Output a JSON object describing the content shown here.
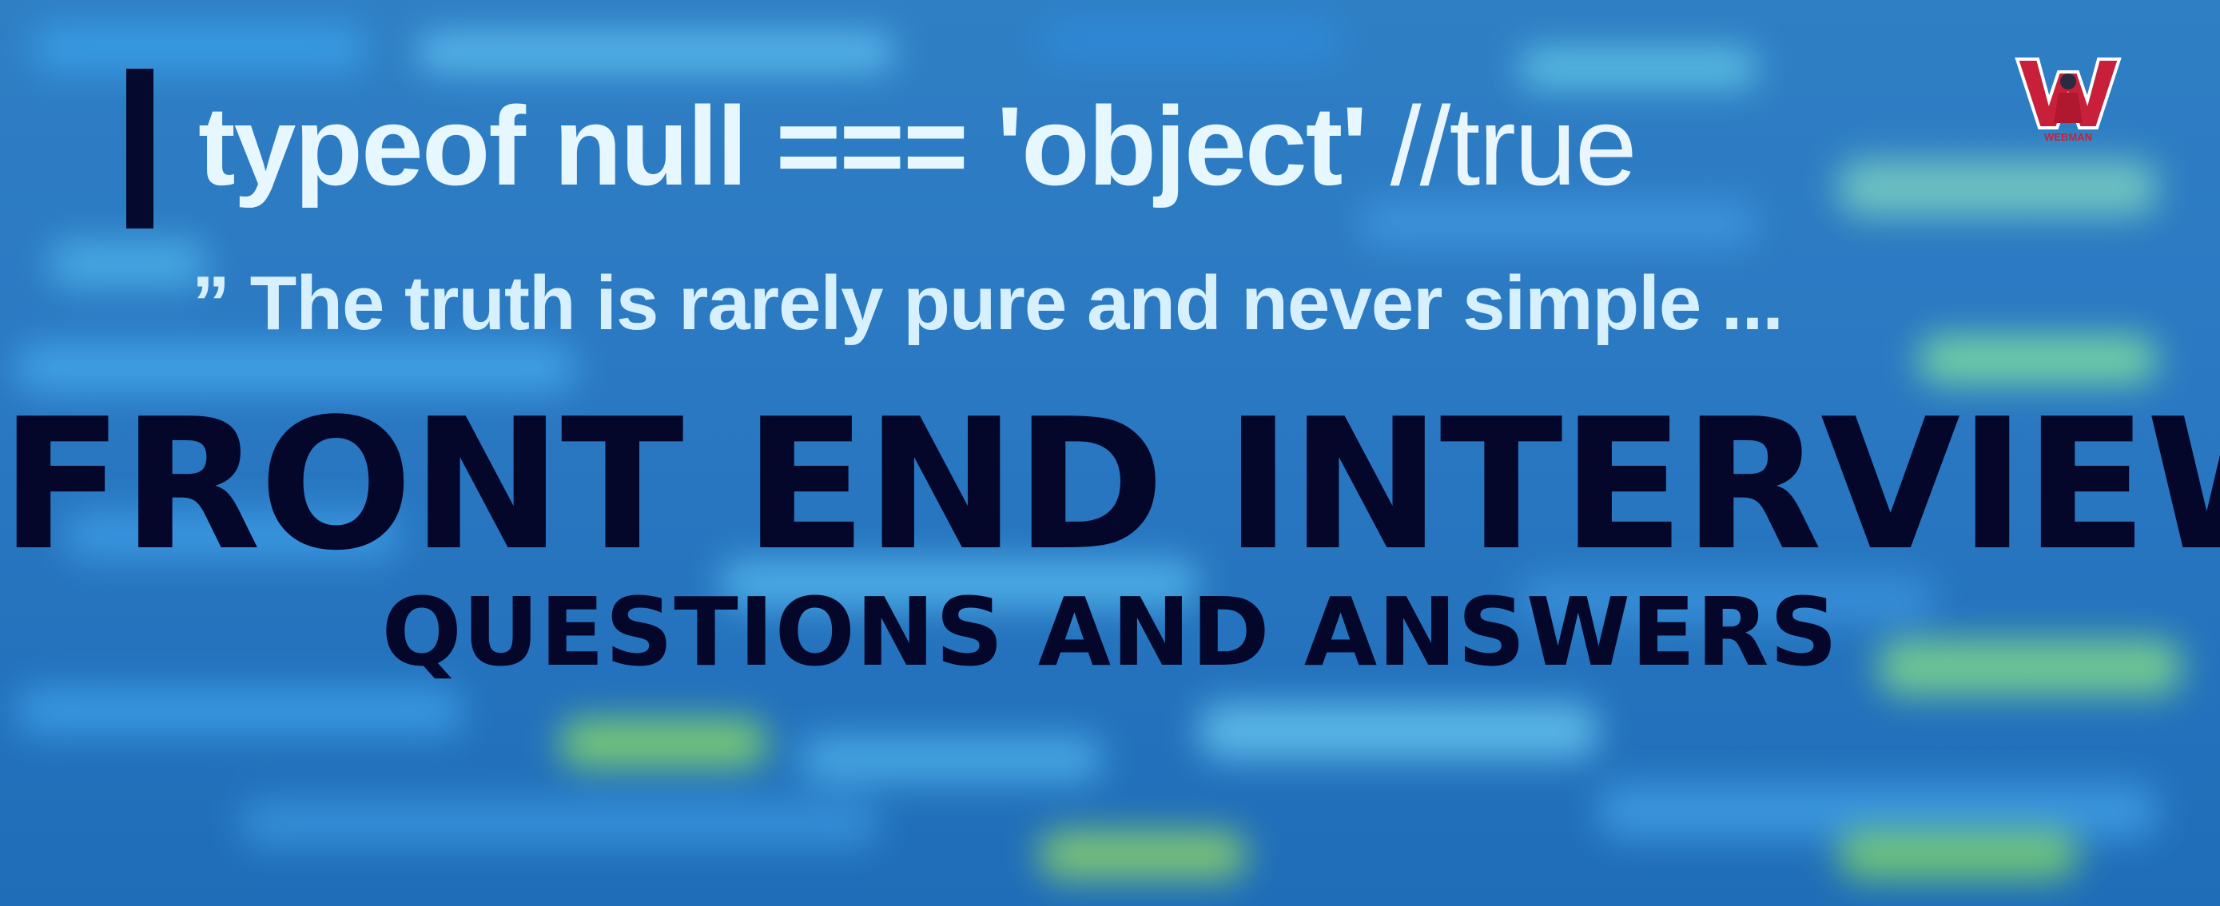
{
  "banner": {
    "code_line": "typeof null === 'object'",
    "code_comment": "//true",
    "quote": "” The truth is rarely pure and never simple ...",
    "title": "FRONT END INTERVIEW",
    "subtitle": "QUESTIONS AND ANSWERS",
    "logo_text": "WEBMAN"
  },
  "colors": {
    "background": "#2a78c2",
    "title": "#04062a",
    "code_text": "#e6f7ff",
    "quote_text": "#d6f0ff",
    "logo_red": "#c8203a"
  }
}
